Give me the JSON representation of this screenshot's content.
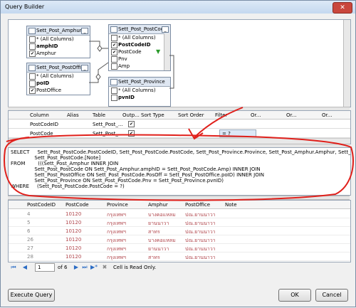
{
  "window": {
    "title": "Query Builder",
    "close_glyph": "✕"
  },
  "diagram": {
    "tables": [
      {
        "name": "Sett_Post_Amphur",
        "columns": [
          {
            "label": "* (All Columns)",
            "checked": false,
            "bold": false
          },
          {
            "label": "amphID",
            "checked": false,
            "bold": true
          },
          {
            "label": "Amphur",
            "checked": true,
            "bold": false
          }
        ]
      },
      {
        "name": "Sett_Post_PostCode",
        "columns": [
          {
            "label": "* (All Columns)",
            "checked": false,
            "bold": false
          },
          {
            "label": "PostCodeID",
            "checked": true,
            "bold": true
          },
          {
            "label": "PostCode",
            "checked": true,
            "bold": false
          },
          {
            "label": "Pnv",
            "checked": false,
            "bold": false
          },
          {
            "label": "Amp",
            "checked": false,
            "bold": false
          }
        ]
      },
      {
        "name": "Sett_Post_PostOffice",
        "columns": [
          {
            "label": "* (All Columns)",
            "checked": false,
            "bold": false
          },
          {
            "label": "poID",
            "checked": false,
            "bold": true
          },
          {
            "label": "PostOffice",
            "checked": true,
            "bold": false
          }
        ]
      },
      {
        "name": "Sett_Post_Province",
        "columns": [
          {
            "label": "* (All Columns)",
            "checked": false,
            "bold": false
          },
          {
            "label": "pvnID",
            "checked": false,
            "bold": true
          }
        ]
      }
    ],
    "min_glyph": "_"
  },
  "criteria": {
    "headers": [
      "Column",
      "Alias",
      "Table",
      "Outp...",
      "Sort Type",
      "Sort Order",
      "Filter",
      "Or...",
      "Or...",
      "Or..."
    ],
    "rows": [
      {
        "column": "PostCodeID",
        "alias": "",
        "table": "Sett_Post_...",
        "output": true,
        "filter": ""
      },
      {
        "column": "PostCode",
        "alias": "",
        "table": "Sett_Post_...",
        "output": true,
        "filter": "= ?"
      }
    ]
  },
  "sql": {
    "lines": [
      "SELECT     Sett_Post_PostCode.PostCodeID, Sett_Post_PostCode.PostCode, Sett_Post_Province.Province, Sett_Post_Amphur.Amphur, Sett_Post_PostOffice.PostOffice,",
      "               Sett_Post_PostCode.[Note]",
      "FROM        (((Sett_Post_Amphur INNER JOIN",
      "               Sett_Post_PostCode ON Sett_Post_Amphur.amphID = Sett_Post_PostCode.Amp) INNER JOIN",
      "               Sett_Post_PostOffice ON Sett_Post_PostCode.PosOff = Sett_Post_PostOffice.poID) INNER JOIN",
      "               Sett_Post_Province ON Sett_Post_PostCode.Pnv = Sett_Post_Province.pvnID)",
      "WHERE     (Sett_Post_PostCode.PostCode = ?)"
    ]
  },
  "results": {
    "headers": [
      "PostCodeID",
      "PostCode",
      "Province",
      "Amphur",
      "PostOffice",
      "Note"
    ],
    "rows": [
      [
        "4",
        "10120",
        "กรุงเทพฯ",
        "บางคอแหลม",
        "ปณ.ยานนาวา",
        ""
      ],
      [
        "5",
        "10120",
        "กรุงเทพฯ",
        "ยานนาวา",
        "ปณ.ยานนาวา",
        ""
      ],
      [
        "6",
        "10120",
        "กรุงเทพฯ",
        "สาทร",
        "ปณ.ยานนาวา",
        ""
      ],
      [
        "26",
        "10120",
        "กรุงเทพฯ",
        "บางคอแหลม",
        "ปณ.ยานนาวา",
        ""
      ],
      [
        "27",
        "10120",
        "กรุงเทพฯ",
        "ยานนาวา",
        "ปณ.ยานนาวา",
        ""
      ],
      [
        "28",
        "10120",
        "กรุงเทพฯ",
        "สาทร",
        "ปณ.ยานนาวา",
        ""
      ]
    ]
  },
  "navigator": {
    "page": "1",
    "of_text": "of 6",
    "status": "Cell is Read Only.",
    "glyphs": {
      "first": "⏮",
      "prev": "◀",
      "next": "▶",
      "last": "⏭",
      "add": "▶*",
      "stop": "✖"
    }
  },
  "buttons": {
    "execute": "Execute Query",
    "ok": "OK",
    "cancel": "Cancel"
  },
  "colors": {
    "annotation": "#e0201b",
    "selection": "#dce8f7"
  }
}
